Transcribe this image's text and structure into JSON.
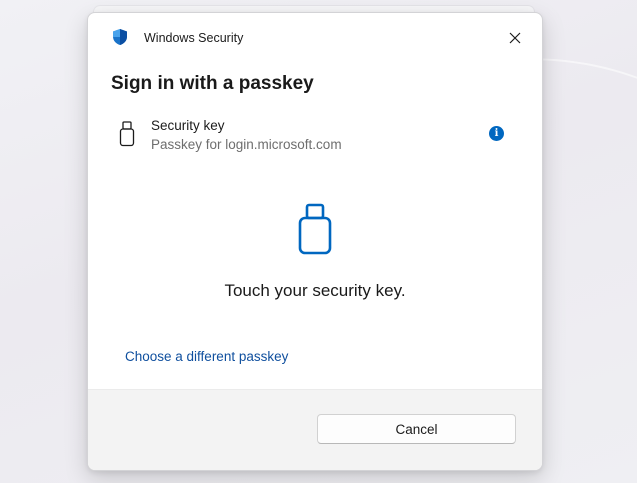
{
  "window": {
    "title": "Windows Security",
    "app_icon": "shield-icon",
    "close_icon": "close-icon"
  },
  "dialog": {
    "heading": "Sign in with a passkey",
    "method": {
      "icon": "usb-key-icon",
      "title": "Security key",
      "subtitle": "Passkey for login.microsoft.com",
      "info_icon": "info-icon",
      "info_glyph": "i"
    },
    "prompt_icon": "usb-key-icon",
    "prompt_text": "Touch your security key.",
    "link_text": "Choose a different passkey"
  },
  "footer": {
    "cancel_label": "Cancel"
  },
  "colors": {
    "accent": "#0067c0",
    "link": "#0f4f9e",
    "footer_bg": "#f3f3f3"
  }
}
